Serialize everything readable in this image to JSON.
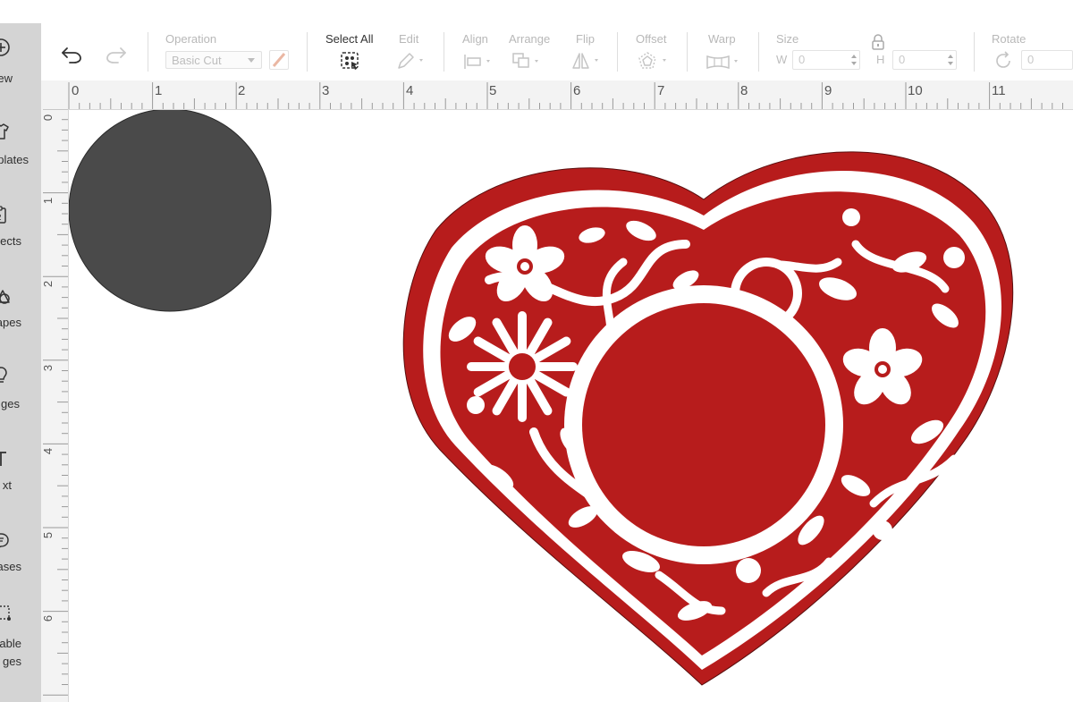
{
  "colors": {
    "accent_red": "#b71c1c",
    "circle_dark": "#4a4a4a",
    "panel_gray": "#d4d4d4",
    "disabled_text": "#b8b8b8"
  },
  "left_panel": {
    "items": [
      {
        "label": "ew",
        "icon": "plus-circle-icon"
      },
      {
        "label": "plates",
        "icon": "shirt-icon"
      },
      {
        "label": "ects",
        "icon": "clipboard-icon"
      },
      {
        "label": "apes",
        "icon": "shapes-icon"
      },
      {
        "label": "ges",
        "icon": "lightbulb-icon"
      },
      {
        "label": "xt",
        "icon": "text-icon"
      },
      {
        "label": "ases",
        "icon": "chat-icon"
      },
      {
        "label": "able\nges",
        "icon": "editable-image-icon"
      }
    ]
  },
  "toolbar": {
    "operation_label": "Operation",
    "operation_value": "Basic Cut",
    "select_all_label": "Select All",
    "edit_label": "Edit",
    "align_label": "Align",
    "arrange_label": "Arrange",
    "flip_label": "Flip",
    "offset_label": "Offset",
    "warp_label": "Warp",
    "size_label": "Size",
    "width_letter": "W",
    "height_letter": "H",
    "width_value": "0",
    "height_value": "0",
    "rotate_label": "Rotate",
    "rotate_value": "0"
  },
  "ruler": {
    "top_numbers": [
      "0",
      "1",
      "2",
      "3",
      "4",
      "5",
      "6",
      "7",
      "8",
      "9",
      "10",
      "11"
    ],
    "left_numbers": [
      "0",
      "1",
      "2",
      "3",
      "4",
      "5",
      "6"
    ]
  },
  "canvas": {
    "shapes": [
      {
        "name": "dark-circle",
        "color": "#4a4a4a"
      },
      {
        "name": "floral-heart",
        "color": "#b71c1c"
      }
    ]
  }
}
